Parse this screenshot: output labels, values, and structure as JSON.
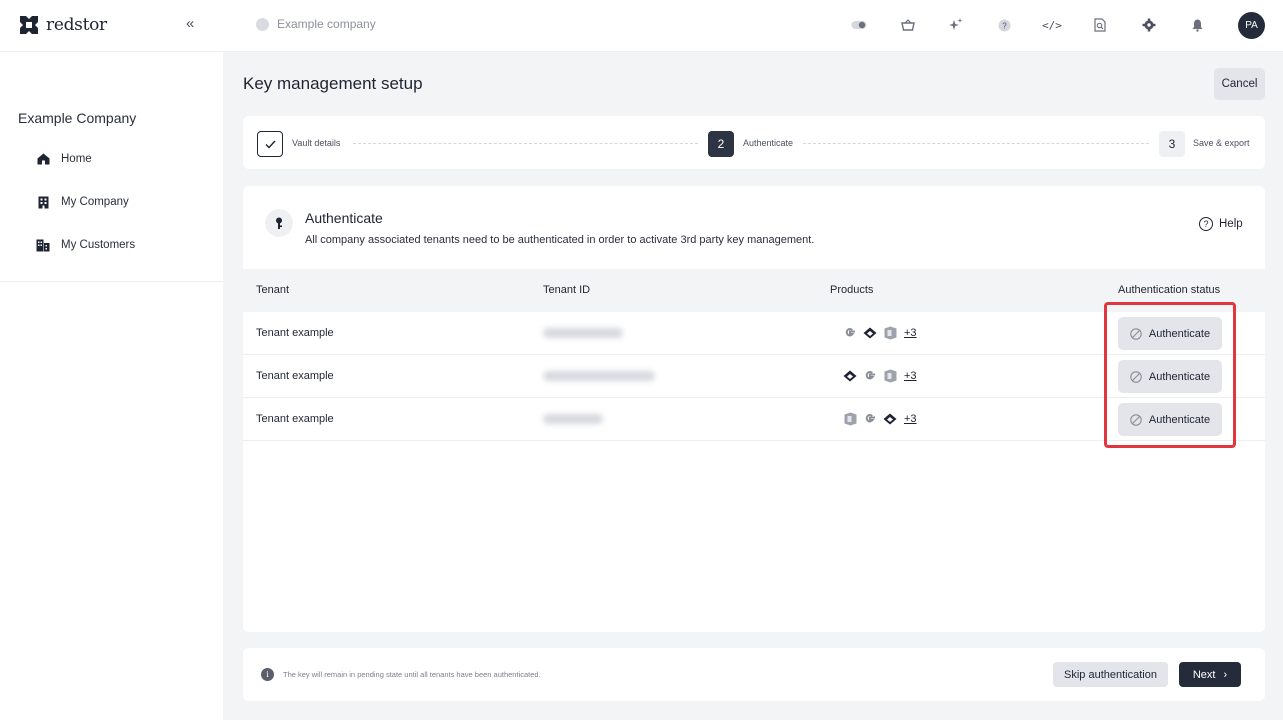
{
  "brand": {
    "name": "redstor",
    "logo_icon": "redstor-logo"
  },
  "topbar": {
    "collapse_icon": "double-chevron-left-icon",
    "company_selector": "Example company",
    "icons": [
      "toggle-icon",
      "basket-icon",
      "sparkle-icon",
      "question-icon",
      "code-icon",
      "search-doc-icon",
      "gear-icon",
      "bell-icon"
    ],
    "avatar": "PA"
  },
  "sidebar": {
    "company": "Example Company",
    "items": [
      {
        "label": "Home",
        "icon": "home-icon"
      },
      {
        "label": "My Company",
        "icon": "building-icon"
      },
      {
        "label": "My Customers",
        "icon": "buildings-icon"
      }
    ]
  },
  "page": {
    "title": "Key management setup",
    "cancel_label": "Cancel"
  },
  "stepper": {
    "steps": [
      {
        "number": "1",
        "label": "Vault details",
        "state": "completed"
      },
      {
        "number": "2",
        "label": "Authenticate",
        "state": "active"
      },
      {
        "number": "3",
        "label": "Save & export",
        "state": "pending"
      }
    ]
  },
  "authenticate": {
    "title": "Authenticate",
    "description": "All company associated tenants need to be authenticated in order to activate 3rd party key management.",
    "help_label": "Help",
    "table": {
      "columns": [
        "Tenant",
        "Tenant ID",
        "Products",
        "Authentication status"
      ],
      "rows": [
        {
          "tenant": "Tenant example",
          "products": [
            "google-icon",
            "drive-icon",
            "office-icon"
          ],
          "more": "+3",
          "status": "Authenticate"
        },
        {
          "tenant": "Tenant example",
          "products": [
            "drive-icon",
            "google-icon",
            "office-icon"
          ],
          "more": "+3",
          "status": "Authenticate"
        },
        {
          "tenant": "Tenant example",
          "products": [
            "office-icon",
            "google-icon",
            "drive-icon"
          ],
          "more": "+3",
          "status": "Authenticate"
        }
      ]
    }
  },
  "footer": {
    "note": "The key will remain in pending state until all tenants have been authenticated.",
    "skip_label": "Skip authentication",
    "next_label": "Next"
  },
  "colors": {
    "highlight": "#e0373f",
    "primary_dark": "#262b3b",
    "button_grey": "#e3e5ea"
  }
}
